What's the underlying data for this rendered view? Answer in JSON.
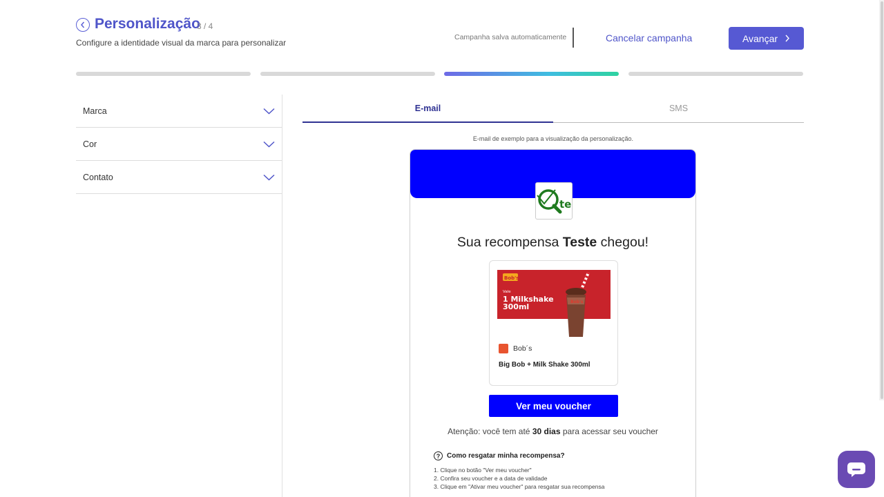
{
  "header": {
    "title": "Personalização",
    "step": "3 / 4",
    "subtitle": "Configure a identidade visual da marca para personalizar",
    "autosave": "Campanha salva automaticamente",
    "cancel_label": "Cancelar campanha",
    "advance_label": "Avançar"
  },
  "progress": {
    "current_step": 3,
    "total_steps": 4
  },
  "sidebar": {
    "items": [
      {
        "label": "Marca"
      },
      {
        "label": "Cor"
      },
      {
        "label": "Contato"
      }
    ]
  },
  "tabs": [
    {
      "label": "E-mail",
      "active": true
    },
    {
      "label": "SMS",
      "active": false
    }
  ],
  "preview": {
    "note": "E-mail de exemplo para a visualização da personalização.",
    "headline_pre": "Sua recompensa ",
    "headline_brand": "Teste",
    "headline_post": " chegou!",
    "voucher": {
      "brand_badge": "Bob's",
      "label": "Vale",
      "title_line1": "1 Milkshake",
      "title_line2": "300ml",
      "brand": "Bob´s",
      "product": "Big Bob + Milk Shake 300ml"
    },
    "cta_label": "Ver meu voucher",
    "attention_pre": "Atenção: você tem até ",
    "attention_days": "30 dias",
    "attention_post": " para acessar seu voucher",
    "howto_title": "Como resgatar minha recompensa?",
    "steps": [
      "1. Clique no botão \"Ver meu voucher\"",
      "2. Confira seu voucher e a data de validade",
      "3. Clique em \"Ativar meu voucher\" para resgatar sua recompensa"
    ],
    "banner_color": "#0000ff"
  },
  "colors": {
    "accent": "#5659d3",
    "title": "#4f55c9",
    "tab_active": "#2e3192"
  }
}
